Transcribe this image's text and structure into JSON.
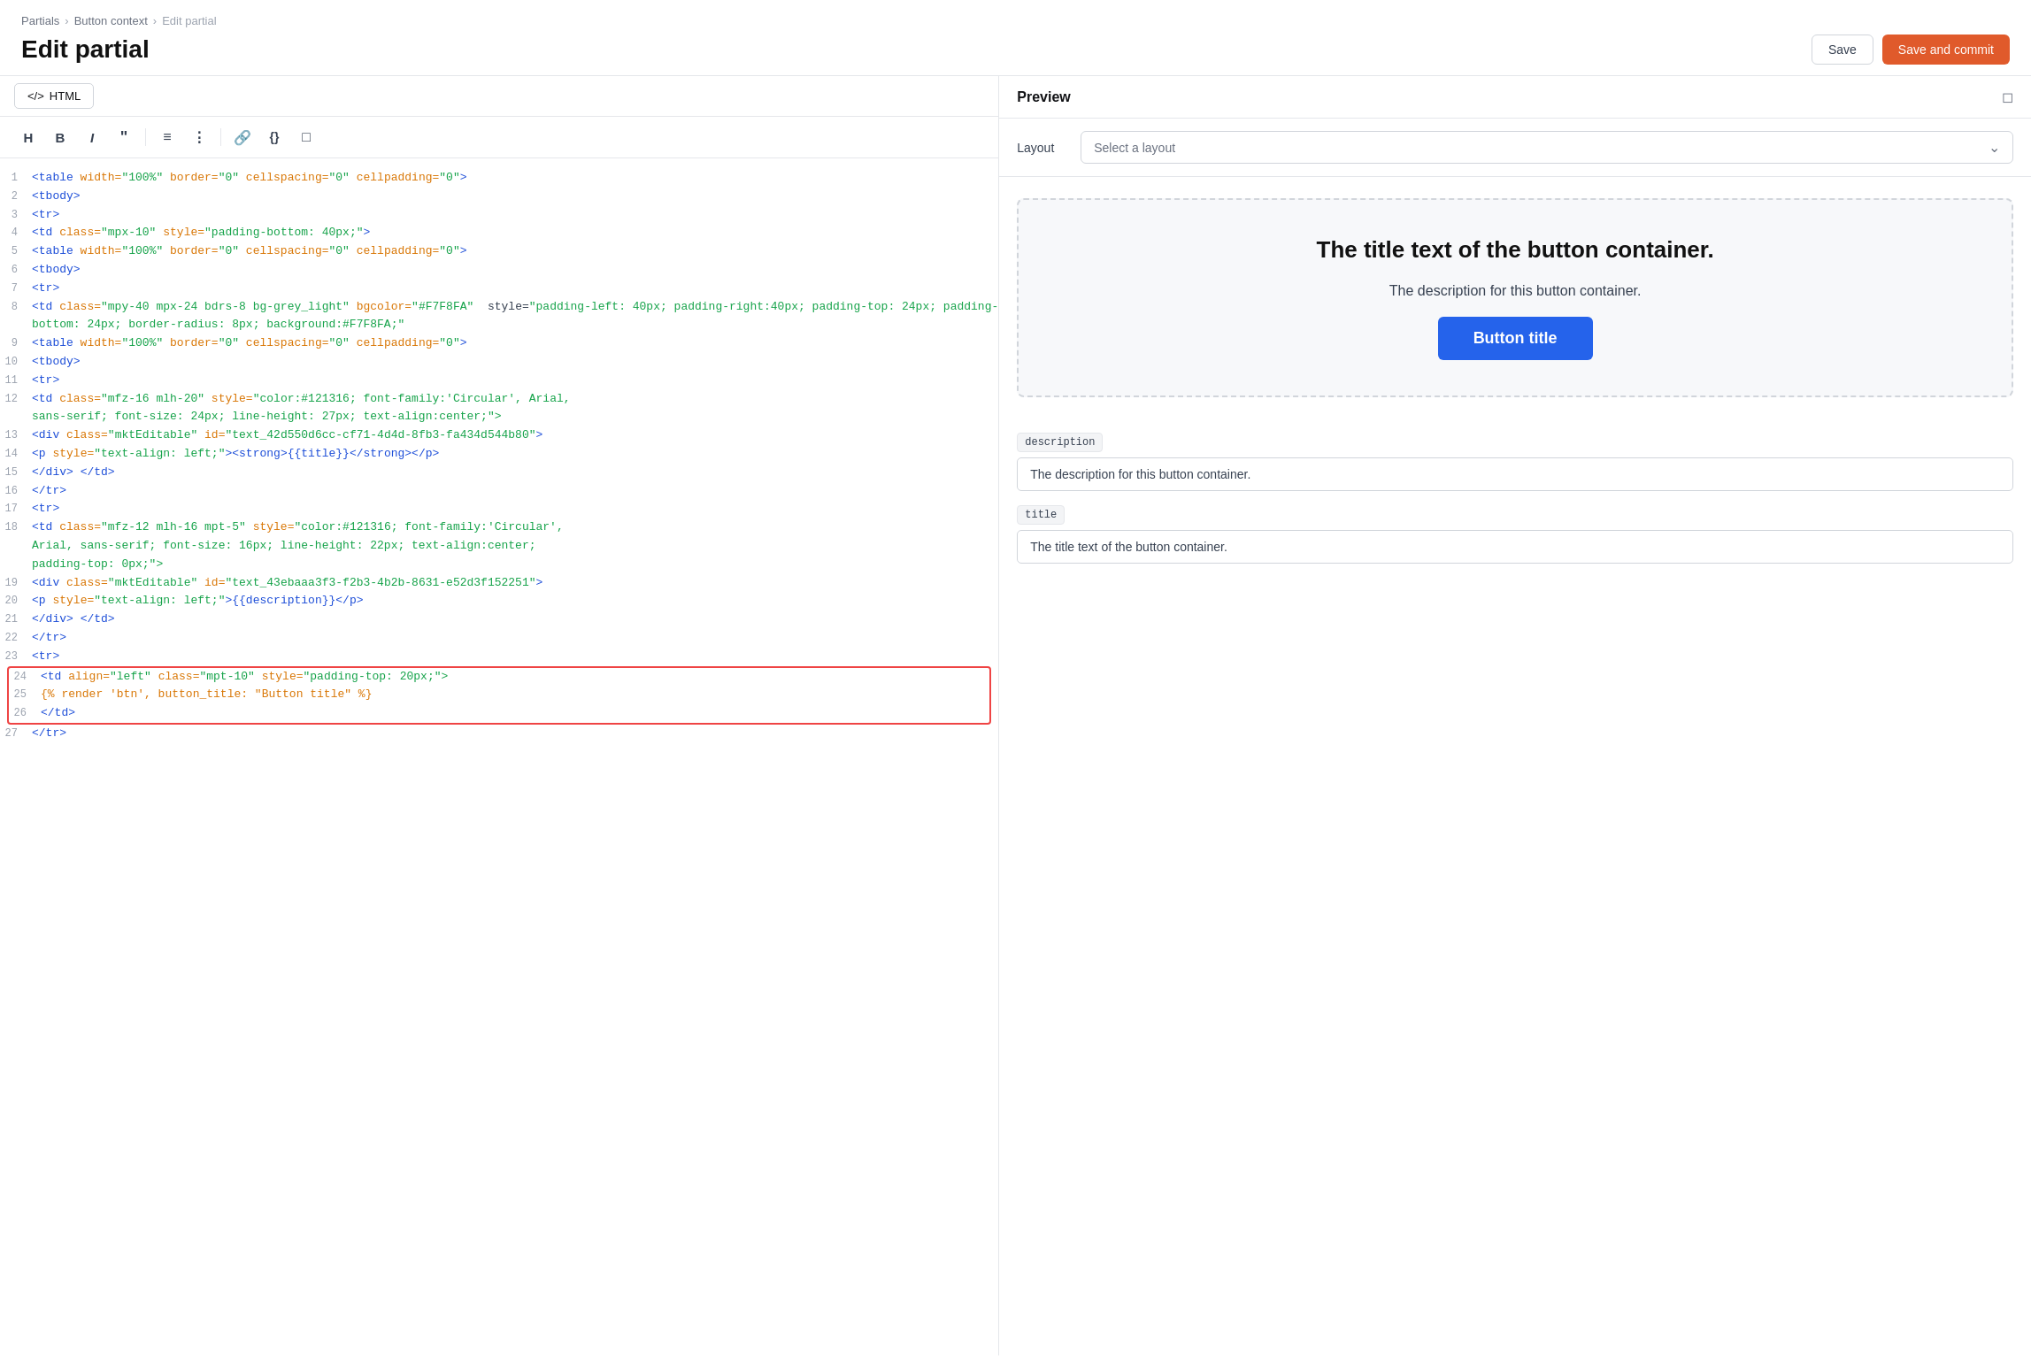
{
  "breadcrumb": {
    "items": [
      "Partials",
      "Button context",
      "Edit partial"
    ]
  },
  "header": {
    "title": "Edit partial",
    "save_label": "Save",
    "save_commit_label": "Save and commit"
  },
  "editor": {
    "tab_label": "HTML",
    "toolbar": {
      "h": "H",
      "b": "B",
      "i": "I",
      "quote": "”",
      "ol": "OL",
      "ul": "UL",
      "link": "🔗",
      "code": "{}",
      "embed": "⊡"
    },
    "lines": [
      {
        "num": 1,
        "tokens": [
          {
            "t": "tag",
            "v": "<table"
          },
          {
            "t": "attr",
            "v": " width="
          },
          {
            "t": "val",
            "v": "\"100%\""
          },
          {
            "t": "attr",
            "v": " border="
          },
          {
            "t": "val",
            "v": "\"0\""
          },
          {
            "t": "attr",
            "v": " cellspacing="
          },
          {
            "t": "val",
            "v": "\"0\""
          },
          {
            "t": "attr",
            "v": " cellpadding="
          },
          {
            "t": "val",
            "v": "\"0\""
          },
          {
            "t": "tag",
            "v": ">"
          }
        ]
      },
      {
        "num": 2,
        "tokens": [
          {
            "t": "tag",
            "v": "<tbody>"
          }
        ]
      },
      {
        "num": 3,
        "tokens": [
          {
            "t": "tag",
            "v": "<tr>"
          }
        ]
      },
      {
        "num": 4,
        "tokens": [
          {
            "t": "tag",
            "v": "<td"
          },
          {
            "t": "attr",
            "v": " class="
          },
          {
            "t": "val",
            "v": "\"mpx-10\""
          },
          {
            "t": "plain",
            "v": " "
          },
          {
            "t": "attr",
            "v": "style="
          },
          {
            "t": "val",
            "v": "\"padding-bottom: 40px;\""
          },
          {
            "t": "tag",
            "v": ">"
          }
        ]
      },
      {
        "num": 5,
        "tokens": [
          {
            "t": "tag",
            "v": "<table"
          },
          {
            "t": "attr",
            "v": " width="
          },
          {
            "t": "val",
            "v": "\"100%\""
          },
          {
            "t": "attr",
            "v": " border="
          },
          {
            "t": "val",
            "v": "\"0\""
          },
          {
            "t": "attr",
            "v": " cellspacing="
          },
          {
            "t": "val",
            "v": "\"0\""
          },
          {
            "t": "attr",
            "v": " cellpadding="
          },
          {
            "t": "val",
            "v": "\"0\""
          },
          {
            "t": "tag",
            "v": ">"
          }
        ]
      },
      {
        "num": 6,
        "tokens": [
          {
            "t": "tag",
            "v": "<tbody>"
          }
        ]
      },
      {
        "num": 7,
        "tokens": [
          {
            "t": "tag",
            "v": "<tr>"
          }
        ]
      },
      {
        "num": 8,
        "tokens": [
          {
            "t": "tag",
            "v": "<td"
          },
          {
            "t": "attr",
            "v": " class="
          },
          {
            "t": "val",
            "v": "\"mpy-40 mpx-24 bdrs-8 bg-grey_light\""
          },
          {
            "t": "plain",
            "v": " "
          },
          {
            "t": "attr",
            "v": "bgcolor="
          },
          {
            "t": "val",
            "v": "\"#F7F8FA\""
          },
          {
            "t": "plain",
            "v": "  style="
          },
          {
            "t": "val",
            "v": "\"padding-left: 40px; padding-right:40px; padding-top: 24px; padding-"
          }
        ]
      },
      {
        "num": null,
        "tokens": [
          {
            "t": "val",
            "v": "bottom: 24px; border-radius: 8px; background:#F7F8FA;\""
          }
        ]
      },
      {
        "num": 9,
        "tokens": [
          {
            "t": "tag",
            "v": "<table"
          },
          {
            "t": "attr",
            "v": " width="
          },
          {
            "t": "val",
            "v": "\"100%\""
          },
          {
            "t": "attr",
            "v": " border="
          },
          {
            "t": "val",
            "v": "\"0\""
          },
          {
            "t": "attr",
            "v": " cellspacing="
          },
          {
            "t": "val",
            "v": "\"0\""
          },
          {
            "t": "attr",
            "v": " cellpadding="
          },
          {
            "t": "val",
            "v": "\"0\""
          },
          {
            "t": "tag",
            "v": ">"
          }
        ]
      },
      {
        "num": 10,
        "tokens": [
          {
            "t": "tag",
            "v": "<tbody>"
          }
        ]
      },
      {
        "num": 11,
        "tokens": [
          {
            "t": "tag",
            "v": "<tr>"
          }
        ]
      },
      {
        "num": 12,
        "tokens": [
          {
            "t": "tag",
            "v": "<td"
          },
          {
            "t": "attr",
            "v": " class="
          },
          {
            "t": "val",
            "v": "\"mfz-16 mlh-20\""
          },
          {
            "t": "plain",
            "v": " "
          },
          {
            "t": "attr",
            "v": "style="
          },
          {
            "t": "val",
            "v": "\"color:#121316; font-family:'Circular', Arial,"
          },
          {
            "t": "plain",
            "v": "  "
          },
          {
            "t": "attr",
            "v": ""
          }
        ]
      },
      {
        "num": null,
        "tokens": [
          {
            "t": "val",
            "v": "sans-serif; font-size: 24px; line-height: 27px; text-align:center;\">"
          }
        ]
      },
      {
        "num": 13,
        "tokens": [
          {
            "t": "tag",
            "v": "<div"
          },
          {
            "t": "attr",
            "v": " class="
          },
          {
            "t": "val",
            "v": "\"mktEditable\""
          },
          {
            "t": "plain",
            "v": " "
          },
          {
            "t": "attr",
            "v": "id="
          },
          {
            "t": "val",
            "v": "\"text_42d550d6cc-cf71-4d4d-8fb3-fa434d544b80\""
          },
          {
            "t": "tag",
            "v": ">"
          }
        ]
      },
      {
        "num": 14,
        "tokens": [
          {
            "t": "tag",
            "v": "<p"
          },
          {
            "t": "plain",
            "v": " "
          },
          {
            "t": "attr",
            "v": "style="
          },
          {
            "t": "val",
            "v": "\"text-align: left;\""
          },
          {
            "t": "tag",
            "v": "><strong>{{title}}</strong></p>"
          }
        ]
      },
      {
        "num": 15,
        "tokens": [
          {
            "t": "tag",
            "v": "</div>"
          },
          {
            "t": "plain",
            "v": " "
          },
          {
            "t": "tag",
            "v": "</td>"
          }
        ]
      },
      {
        "num": 16,
        "tokens": [
          {
            "t": "tag",
            "v": "</tr>"
          }
        ]
      },
      {
        "num": 17,
        "tokens": [
          {
            "t": "tag",
            "v": "<tr>"
          }
        ]
      },
      {
        "num": 18,
        "tokens": [
          {
            "t": "tag",
            "v": "<td"
          },
          {
            "t": "attr",
            "v": " class="
          },
          {
            "t": "val",
            "v": "\"mfz-12 mlh-16 mpt-5\""
          },
          {
            "t": "plain",
            "v": " "
          },
          {
            "t": "attr",
            "v": "style="
          },
          {
            "t": "val",
            "v": "\"color:#121316; font-family:'Circular',"
          },
          {
            "t": "plain",
            "v": "  "
          },
          {
            "t": "attr",
            "v": ""
          }
        ]
      },
      {
        "num": null,
        "tokens": [
          {
            "t": "val",
            "v": "Arial, sans-serif; font-size: 16px; line-height: 22px; text-align:center;"
          }
        ]
      },
      {
        "num": null,
        "tokens": [
          {
            "t": "val",
            "v": "padding-top: 0px;\">"
          }
        ]
      },
      {
        "num": 19,
        "tokens": [
          {
            "t": "tag",
            "v": "<div"
          },
          {
            "t": "attr",
            "v": " class="
          },
          {
            "t": "val",
            "v": "\"mktEditable\""
          },
          {
            "t": "plain",
            "v": " "
          },
          {
            "t": "attr",
            "v": "id="
          },
          {
            "t": "val",
            "v": "\"text_43ebaaa3f3-f2b3-4b2b-8631-e52d3f152251\""
          },
          {
            "t": "tag",
            "v": ">"
          }
        ]
      },
      {
        "num": 20,
        "tokens": [
          {
            "t": "tag",
            "v": "<p"
          },
          {
            "t": "plain",
            "v": " "
          },
          {
            "t": "attr",
            "v": "style="
          },
          {
            "t": "val",
            "v": "\"text-align: left;\""
          },
          {
            "t": "tag",
            "v": ">{{description}}</p>"
          }
        ]
      },
      {
        "num": 21,
        "tokens": [
          {
            "t": "tag",
            "v": "</div>"
          },
          {
            "t": "plain",
            "v": " "
          },
          {
            "t": "tag",
            "v": "</td>"
          }
        ]
      },
      {
        "num": 22,
        "tokens": [
          {
            "t": "tag",
            "v": "</tr>"
          }
        ]
      },
      {
        "num": 23,
        "tokens": [
          {
            "t": "tag",
            "v": "<tr>"
          }
        ]
      },
      {
        "num": 24,
        "tokens": [
          {
            "t": "tag",
            "v": "<td"
          },
          {
            "t": "attr",
            "v": " align="
          },
          {
            "t": "val",
            "v": "\"left\""
          },
          {
            "t": "plain",
            "v": " "
          },
          {
            "t": "attr",
            "v": "class="
          },
          {
            "t": "val",
            "v": "\"mpt-10\""
          },
          {
            "t": "plain",
            "v": " "
          },
          {
            "t": "attr",
            "v": "style="
          },
          {
            "t": "val",
            "v": "\"padding-top: 20px;\">"
          }
        ],
        "highlight": true
      },
      {
        "num": 25,
        "tokens": [
          {
            "t": "liquid",
            "v": "{% render 'btn', button_title: \"Button title\" %}"
          }
        ],
        "highlight": true
      },
      {
        "num": 26,
        "tokens": [
          {
            "t": "tag",
            "v": "</td>"
          }
        ],
        "highlight": true
      },
      {
        "num": 27,
        "tokens": [
          {
            "t": "tag",
            "v": "</tr>"
          }
        ]
      }
    ]
  },
  "preview": {
    "title": "Preview",
    "layout_label": "Layout",
    "layout_placeholder": "Select a layout",
    "card": {
      "title": "The title text of the button container.",
      "description": "The description for this button container.",
      "button_label": "Button title"
    },
    "fields": [
      {
        "label": "description",
        "value": "The description for this button container."
      },
      {
        "label": "title",
        "value": "The title text of the button container."
      }
    ]
  }
}
